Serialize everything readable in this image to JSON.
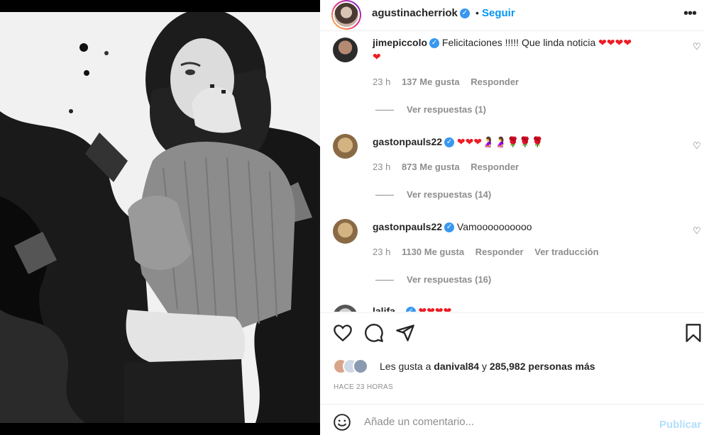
{
  "header": {
    "username": "agustinacherriok",
    "verified": true,
    "separator": "•",
    "follow_label": "Seguir",
    "more_icon": "more-horizontal-icon"
  },
  "comments": [
    {
      "username": "jimepiccolo",
      "verified": true,
      "text": "Felicitaciones !!!!! Que linda noticia",
      "emojis": "❤❤❤❤",
      "emojis_line2": "❤",
      "time": "23 h",
      "likes": "137 Me gusta",
      "reply": "Responder",
      "view_replies": "Ver respuestas (1)"
    },
    {
      "username": "gastonpauls22",
      "verified": true,
      "text": "",
      "emojis": "❤❤❤🤰🤰🌹🌹🌹",
      "time": "23 h",
      "likes": "873 Me gusta",
      "reply": "Responder",
      "view_replies": "Ver respuestas (14)"
    },
    {
      "username": "gastonpauls22",
      "verified": true,
      "text": "Vamoooooooooo",
      "time": "23 h",
      "likes": "1130 Me gusta",
      "reply": "Responder",
      "translation": "Ver traducción",
      "view_replies": "Ver respuestas (16)"
    },
    {
      "username": "lalifa...",
      "emojis": "❤❤❤❤"
    }
  ],
  "actions": {
    "like_icon": "heart-icon",
    "comment_icon": "comment-icon",
    "share_icon": "send-icon",
    "save_icon": "bookmark-icon"
  },
  "likes_line": {
    "prefix": "Les gusta a",
    "user": "danival84",
    "middle": "y",
    "count": "285,982 personas más"
  },
  "time_ago": "HACE 23 HORAS",
  "comment_box": {
    "placeholder": "Añade un comentario...",
    "publish_label": "Publicar",
    "emoji_icon": "emoji-icon"
  },
  "colors": {
    "link_blue": "#0095f6",
    "publish_disabled": "#b2dffc",
    "verified_blue": "#3897f0",
    "heart_red": "#ed1c24",
    "muted_gray": "#8e8e8e"
  }
}
